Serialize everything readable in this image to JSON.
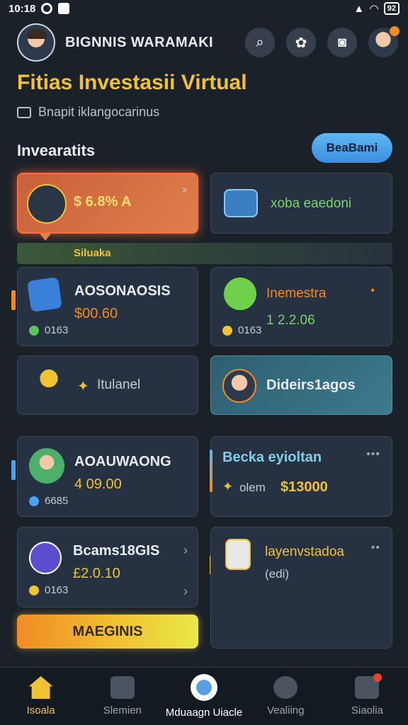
{
  "status": {
    "time": "10:18",
    "battery": "92"
  },
  "header": {
    "brand": "BIGNNIS WARAMAKI"
  },
  "page": {
    "title": "Fitias Investasii Virtual",
    "subtitle": "Bnapit iklangocarinus",
    "section_label": "Invearatits",
    "pill_label": "BeaBami"
  },
  "cards": {
    "c1": {
      "value": "$ 6.8% A",
      "mini": "x"
    },
    "c2": {
      "label": "xoba eaedoni"
    },
    "tooltip": "Siluaka",
    "c3": {
      "title": "AOSONAOSIS",
      "value": "$00.60",
      "meta": "0163"
    },
    "c4": {
      "title": "Inemestra",
      "value": "1 2.2.06",
      "meta": "0163",
      "dot": "•"
    },
    "c5": {
      "title": "Itulanel"
    },
    "c6": {
      "title": "Dideirs1agos"
    },
    "c7": {
      "title": "AOAUWAONG",
      "value": "4 09.00",
      "meta": "6685"
    },
    "c8": {
      "title": "Becka eyioltan",
      "meta": "olem",
      "value": "$13000",
      "dots": "•••"
    },
    "c9": {
      "title": "Bcams18GIS",
      "value": "£2.0.10",
      "meta": "0163",
      "chev": "›"
    },
    "c10": {
      "title": "layenvstadoa",
      "sub": "(edi)",
      "dots": "••"
    }
  },
  "cta_label": "MAEGINIS",
  "nav": [
    {
      "label": "Isoala",
      "active": true
    },
    {
      "label": "Slemien"
    },
    {
      "label": "Mduaagn Uiacle"
    },
    {
      "label": "Vealiing"
    },
    {
      "label": "Siaolia"
    }
  ],
  "colors": {
    "accent": "#f1c232",
    "highlight": "#ff6e3a",
    "pill": "#5fb7f5"
  }
}
